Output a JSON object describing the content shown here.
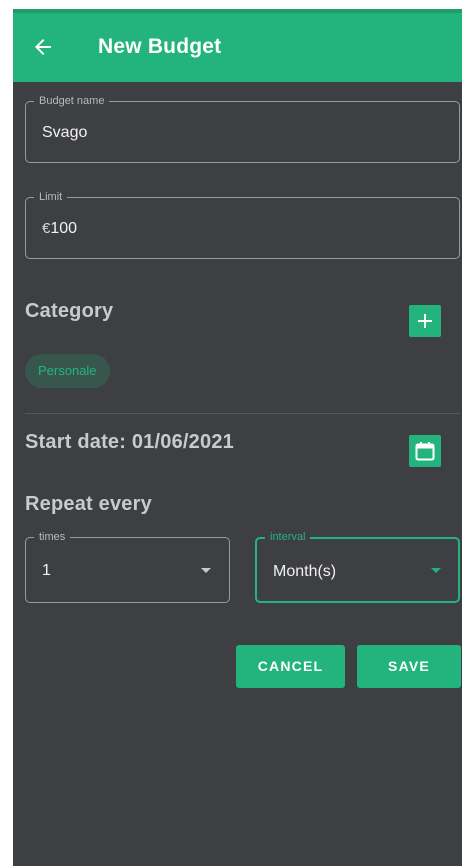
{
  "app_bar": {
    "title": "New Budget",
    "back_icon": "arrow-left-icon"
  },
  "budget_name": {
    "label": "Budget name",
    "value": "Svago"
  },
  "limit": {
    "label": "Limit",
    "currency": "€",
    "value": "100"
  },
  "category": {
    "title": "Category",
    "add_icon": "plus-icon",
    "chips": [
      "Personale"
    ]
  },
  "start_date": {
    "text": "Start date: 01/06/2021",
    "calendar_icon": "calendar-icon"
  },
  "repeat": {
    "title": "Repeat every",
    "times": {
      "label": "times",
      "value": "1"
    },
    "interval": {
      "label": "interval",
      "value": "Month(s)"
    }
  },
  "actions": {
    "cancel": "CANCEL",
    "save": "SAVE"
  },
  "colors": {
    "accent": "#23b47e",
    "background": "#3e3f42",
    "chip_background": "#38574c"
  }
}
